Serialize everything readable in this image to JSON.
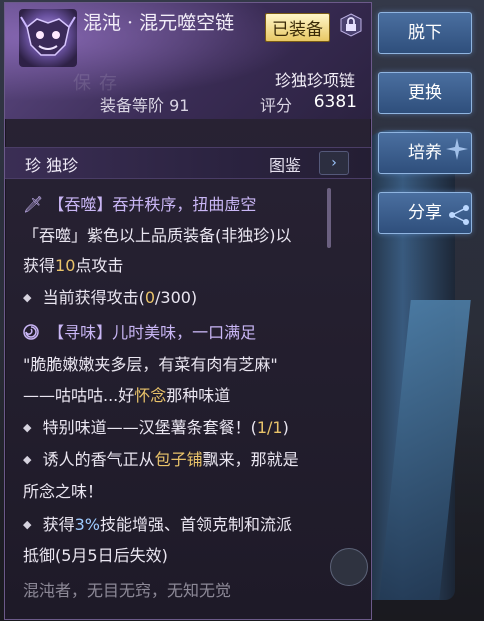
{
  "item": {
    "name": "混沌 · 混元噬空链",
    "equipped_badge": "已装备",
    "subtype": "珍独珍项链",
    "level_label": "装备等阶 91",
    "score_label": "评分",
    "score_value": "6381",
    "rarity": "珍 独珍",
    "album_label": "图鉴",
    "album_arrow": "›",
    "bg_watermark": "保存"
  },
  "effects": [
    {
      "icon": "dagger-icon",
      "title": "【吞噬】吞并秩序，扭曲虚空"
    },
    {
      "text": "「吞噬」紫色以上品质装备(非独珍)以"
    },
    {
      "text_a": "获得",
      "num": "10",
      "text_b": "点攻击"
    },
    {
      "text_a": "当前获得攻击(",
      "num": "0",
      "text_b": "/300)"
    },
    {
      "icon": "swirl-icon",
      "title": "【寻味】儿时美味，一口满足"
    },
    {
      "text": "\"脆脆嫩嫩夹多层，有菜有肉有芝麻\""
    },
    {
      "text_a": "——咕咕咕...好",
      "highlight": "怀念",
      "text_b": "那种味道"
    },
    {
      "text_a": "特别味道——汉堡薯条套餐！(",
      "num": "1/1",
      "text_b": ")"
    },
    {
      "text_a": "诱人的香气正从",
      "highlight": "包子铺",
      "text_b": "飘来，那就是"
    },
    {
      "text": "所念之味！"
    },
    {
      "text_a": "获得",
      "num": "3%",
      "text_b": "技能增强、首领克制和流派"
    },
    {
      "text": "抵御(5月5日后失效)"
    },
    {
      "text": "混沌者，无目无窍，无知无觉"
    }
  ],
  "buttons": {
    "unequip": "脱下",
    "replace": "更换",
    "cultivate": "培养",
    "share": "分享"
  },
  "colors": {
    "accent_purple": "#c9b6f5",
    "gold": "#e9c36a",
    "button_blue": "#3b5f8f"
  }
}
